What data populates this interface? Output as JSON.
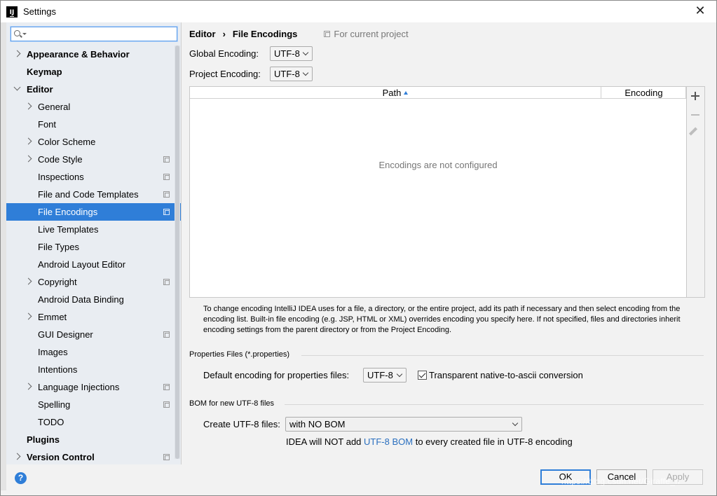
{
  "window": {
    "title": "Settings",
    "app_icon_text": "IJ"
  },
  "sidebar": {
    "search_placeholder": "",
    "items": [
      {
        "label": "Appearance & Behavior",
        "level": 0,
        "bold": true,
        "arrow": "right",
        "copy": false,
        "selected": false
      },
      {
        "label": "Keymap",
        "level": 0,
        "bold": true,
        "arrow": "none",
        "copy": false,
        "selected": false
      },
      {
        "label": "Editor",
        "level": 0,
        "bold": true,
        "arrow": "down",
        "copy": false,
        "selected": false
      },
      {
        "label": "General",
        "level": 1,
        "bold": false,
        "arrow": "right",
        "copy": false,
        "selected": false
      },
      {
        "label": "Font",
        "level": 1,
        "bold": false,
        "arrow": "none",
        "copy": false,
        "selected": false
      },
      {
        "label": "Color Scheme",
        "level": 1,
        "bold": false,
        "arrow": "right",
        "copy": false,
        "selected": false
      },
      {
        "label": "Code Style",
        "level": 1,
        "bold": false,
        "arrow": "right",
        "copy": true,
        "selected": false
      },
      {
        "label": "Inspections",
        "level": 1,
        "bold": false,
        "arrow": "none",
        "copy": true,
        "selected": false
      },
      {
        "label": "File and Code Templates",
        "level": 1,
        "bold": false,
        "arrow": "none",
        "copy": true,
        "selected": false
      },
      {
        "label": "File Encodings",
        "level": 1,
        "bold": false,
        "arrow": "none",
        "copy": true,
        "selected": true
      },
      {
        "label": "Live Templates",
        "level": 1,
        "bold": false,
        "arrow": "none",
        "copy": false,
        "selected": false
      },
      {
        "label": "File Types",
        "level": 1,
        "bold": false,
        "arrow": "none",
        "copy": false,
        "selected": false
      },
      {
        "label": "Android Layout Editor",
        "level": 1,
        "bold": false,
        "arrow": "none",
        "copy": false,
        "selected": false
      },
      {
        "label": "Copyright",
        "level": 1,
        "bold": false,
        "arrow": "right",
        "copy": true,
        "selected": false
      },
      {
        "label": "Android Data Binding",
        "level": 1,
        "bold": false,
        "arrow": "none",
        "copy": false,
        "selected": false
      },
      {
        "label": "Emmet",
        "level": 1,
        "bold": false,
        "arrow": "right",
        "copy": false,
        "selected": false
      },
      {
        "label": "GUI Designer",
        "level": 1,
        "bold": false,
        "arrow": "none",
        "copy": true,
        "selected": false
      },
      {
        "label": "Images",
        "level": 1,
        "bold": false,
        "arrow": "none",
        "copy": false,
        "selected": false
      },
      {
        "label": "Intentions",
        "level": 1,
        "bold": false,
        "arrow": "none",
        "copy": false,
        "selected": false
      },
      {
        "label": "Language Injections",
        "level": 1,
        "bold": false,
        "arrow": "right",
        "copy": true,
        "selected": false
      },
      {
        "label": "Spelling",
        "level": 1,
        "bold": false,
        "arrow": "none",
        "copy": true,
        "selected": false
      },
      {
        "label": "TODO",
        "level": 1,
        "bold": false,
        "arrow": "none",
        "copy": false,
        "selected": false
      },
      {
        "label": "Plugins",
        "level": 0,
        "bold": true,
        "arrow": "none",
        "copy": false,
        "selected": false
      },
      {
        "label": "Version Control",
        "level": 0,
        "bold": true,
        "arrow": "right",
        "copy": true,
        "selected": false
      }
    ]
  },
  "breadcrumb": {
    "parent": "Editor",
    "separator": "›",
    "current": "File Encodings",
    "scope": "For current project"
  },
  "global_encoding": {
    "label": "Global Encoding:",
    "value": "UTF-8"
  },
  "project_encoding": {
    "label": "Project Encoding:",
    "value": "UTF-8"
  },
  "table": {
    "col_path": "Path",
    "col_encoding": "Encoding",
    "empty_text": "Encodings are not configured"
  },
  "description": "To change encoding IntelliJ IDEA uses for a file, a directory, or the entire project, add its path if necessary and then select encoding from the encoding list. Built-in file encoding (e.g. JSP, HTML or XML) overrides encoding you specify here. If not specified, files and directories inherit encoding settings from the parent directory or from the Project Encoding.",
  "properties": {
    "section_title": "Properties Files (*.properties)",
    "default_label": "Default encoding for properties files:",
    "default_value": "UTF-8",
    "transparent_label": "Transparent native-to-ascii conversion",
    "transparent_checked": true
  },
  "bom": {
    "section_title": "BOM for new UTF-8 files",
    "create_label": "Create UTF-8 files:",
    "create_value": "with NO BOM",
    "note_prefix": "IDEA will NOT add ",
    "note_link": "UTF-8 BOM",
    "note_suffix": " to every created file in UTF-8 encoding"
  },
  "footer": {
    "help": "?",
    "ok": "OK",
    "cancel": "Cancel",
    "apply": "Apply"
  },
  "watermark": "https://blog.csdn.net/Giraffe_n"
}
